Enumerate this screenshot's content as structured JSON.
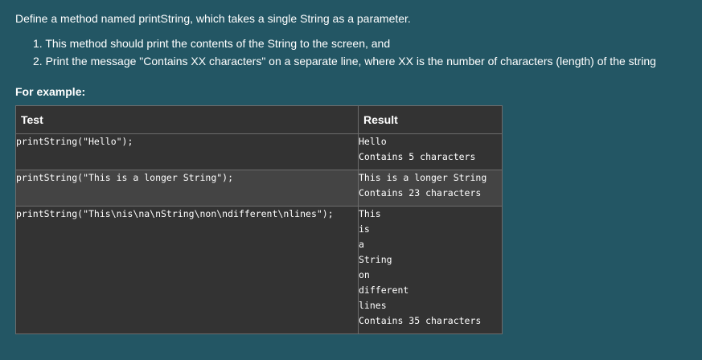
{
  "question": {
    "text": "Define a method named printString, which takes a single String as a parameter.",
    "requirements": [
      "1. This method should print the contents of the String to the screen, and",
      "2. Print the message \"Contains XX characters\" on a separate line, where XX is the number of characters (length) of the string"
    ]
  },
  "example_heading": "For example:",
  "table": {
    "headers": {
      "test": "Test",
      "result": "Result"
    },
    "rows": [
      {
        "test": "printString(\"Hello\");",
        "result": "Hello\nContains 5 characters"
      },
      {
        "test": "printString(\"This is a longer String\");",
        "result": "This is a longer String\nContains 23 characters"
      },
      {
        "test": "printString(\"This\\nis\\na\\nString\\non\\ndifferent\\nlines\");",
        "result": "This\nis\na\nString\non\ndifferent\nlines\nContains 35 characters"
      }
    ]
  },
  "colors": {
    "page_background": "#235664",
    "table_background": "#333333",
    "table_alt_row": "#444444",
    "table_border": "#6c6c6c",
    "text": "#ffffff"
  }
}
